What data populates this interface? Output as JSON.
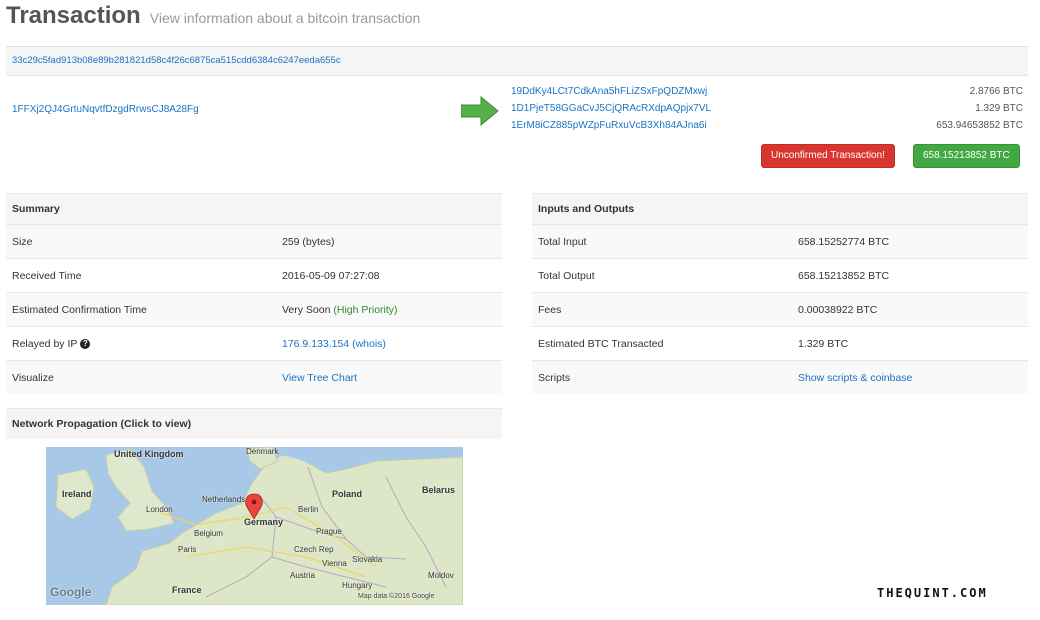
{
  "header": {
    "title": "Transaction",
    "subtitle": "View information about a bitcoin transaction"
  },
  "tx_hash": "33c29c5fad913b08e89b281821d58c4f26c6875ca515cdd6384c6247eeda655c",
  "input_address": "1FFXj2QJ4GrtuNqvtfDzgdRrwsCJ8A28Fg",
  "outputs": [
    {
      "address": "19DdKy4LCt7CdkAna5hFLiZSxFpQDZMxwj",
      "amount": "2.8766 BTC"
    },
    {
      "address": "1D1PjeT58GGaCvJ5CjQRAcRXdpAQpjx7VL",
      "amount": "1.329 BTC"
    },
    {
      "address": "1ErM8iCZ885pWZpFuRxuVcB3Xh84AJna6i",
      "amount": "653.94653852 BTC"
    }
  ],
  "status_button": "Unconfirmed Transaction!",
  "total_button": "658.15213852 BTC",
  "summary": {
    "title": "Summary",
    "size_label": "Size",
    "size_value": "259 (bytes)",
    "received_label": "Received Time",
    "received_value": "2016-05-09 07:27:08",
    "confirm_label": "Estimated Confirmation Time",
    "confirm_value": "Very Soon",
    "confirm_priority": "(High Priority)",
    "relayed_label": "Relayed by IP",
    "relayed_ip": "176.9.133.154",
    "relayed_whois": "(whois)",
    "visualize_label": "Visualize",
    "visualize_link": "View Tree Chart"
  },
  "io": {
    "title": "Inputs and Outputs",
    "total_input_label": "Total Input",
    "total_input_value": "658.15252774 BTC",
    "total_output_label": "Total Output",
    "total_output_value": "658.15213852 BTC",
    "fees_label": "Fees",
    "fees_value": "0.00038922 BTC",
    "est_label": "Estimated BTC Transacted",
    "est_value": "1.329 BTC",
    "scripts_label": "Scripts",
    "scripts_link": "Show scripts & coinbase"
  },
  "network": {
    "title": "Network Propagation (Click to view)",
    "map_labels": [
      "United Kingdom",
      "Ireland",
      "London",
      "Denmark",
      "Netherlands",
      "Berlin",
      "Germany",
      "Poland",
      "Belarus",
      "Belgium",
      "Paris",
      "France",
      "Prague",
      "Czech Rep",
      "Vienna",
      "Austria",
      "Slovakia",
      "Hungary",
      "Moldov"
    ],
    "map_credit": "Map data ©2016 Google",
    "google_logo": "Google"
  },
  "watermark": "THEQUINT.COM",
  "colors": {
    "link": "#1a73c5",
    "danger": "#d9352f",
    "success": "#42a842",
    "priority": "#2f8a2f"
  }
}
